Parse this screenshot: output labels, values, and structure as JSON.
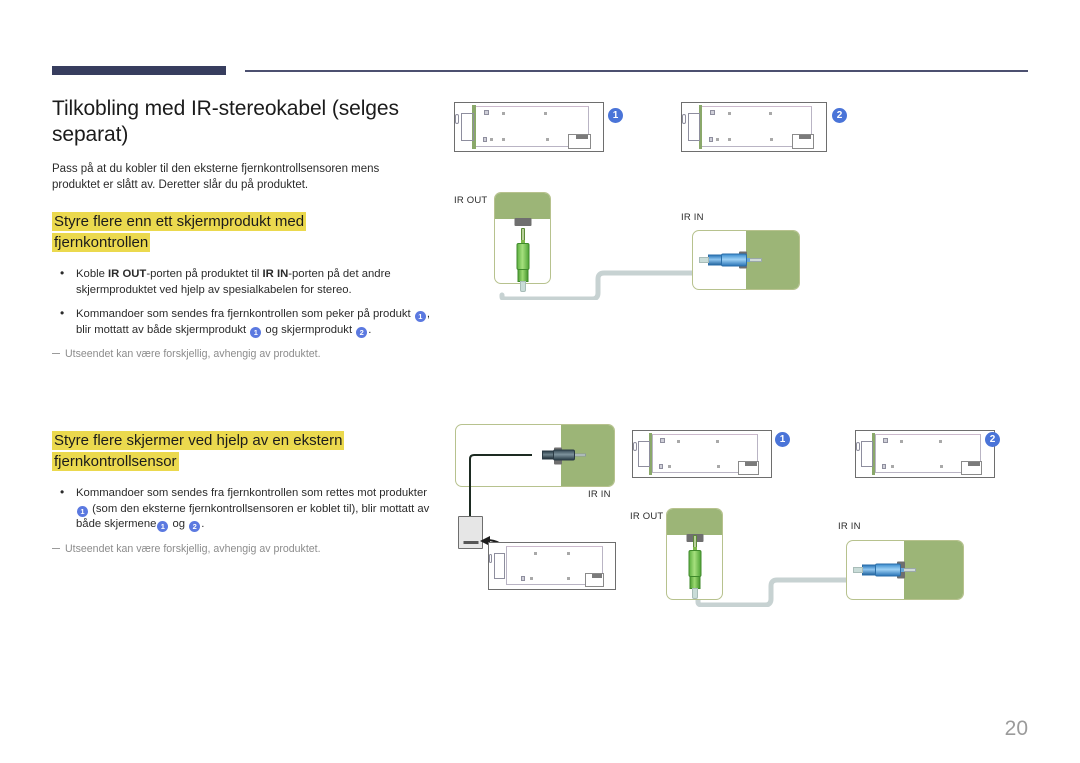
{
  "page": {
    "number": "20",
    "title": "Tilkobling med IR-stereokabel (selges separat)",
    "intro": "Pass på at du kobler til den eksterne fjernkontrollsensoren mens produktet er slått av. Deretter slår du på produktet."
  },
  "section1": {
    "heading": "Styre flere enn ett skjermprodukt med fjernkontrollen",
    "bullet1": {
      "pre": "Koble ",
      "bold1": "IR OUT",
      "mid": "-porten på produktet til ",
      "bold2": "IR IN",
      "post": "-porten på det andre skjermproduktet ved hjelp av spesialkabelen for stereo."
    },
    "bullet2": {
      "part1": "Kommandoer som sendes fra fjernkontrollen som peker på produkt ",
      "badge1": "1",
      "part2": ", blir mottatt av både skjermprodukt ",
      "badge2": "1",
      "part3": " og skjermprodukt ",
      "badge3": "2",
      "part4": "."
    },
    "note": "Utseendet kan være forskjellig, avhengig av produktet."
  },
  "section2": {
    "heading": "Styre flere skjermer ved hjelp av en ekstern fjernkontrollsensor",
    "bullet1": {
      "part1": "Kommandoer som sendes fra fjernkontrollen som rettes mot produkter",
      "badge1": "1",
      "part2": " (som den eksterne fjernkontrollsensoren er koblet til), blir mottatt av både skjermene",
      "badge2": "1",
      "part3": " og ",
      "badge3": "2",
      "part4": "."
    },
    "note": "Utseendet kan være forskjellig, avhengig av produktet."
  },
  "diagram1": {
    "device1_badge": "1",
    "device2_badge": "2",
    "ir_out_label": "IR OUT",
    "ir_in_label": "IR IN"
  },
  "diagram2": {
    "ir_in_label_left": "IR IN",
    "device1_badge": "1",
    "device2_badge": "2",
    "ir_out_label": "IR OUT",
    "ir_in_label": "IR IN"
  },
  "colors": {
    "highlight": "#ebd94e",
    "header_bar": "#373d5e",
    "badge_blue": "#4a74d8",
    "panel_green": "#9cb577",
    "page_number": "#9b9b9b"
  }
}
